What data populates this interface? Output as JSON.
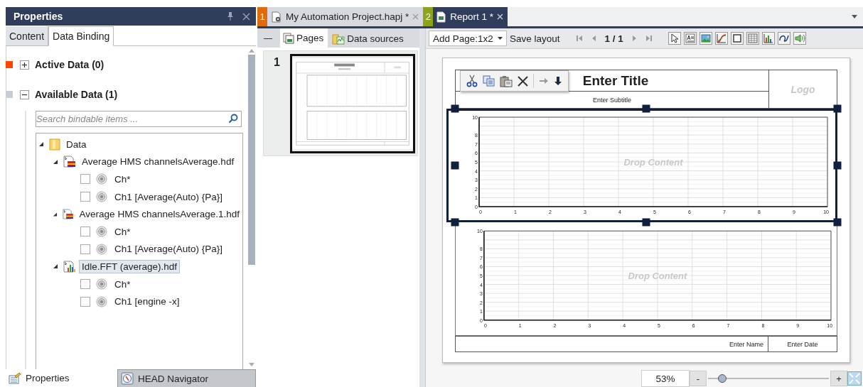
{
  "panel": {
    "title": "Properties",
    "tabs": [
      {
        "label": "Content",
        "selected": false
      },
      {
        "label": "Data Binding",
        "selected": true
      }
    ],
    "sections": [
      {
        "title": "Active Data (0)",
        "expanded": false,
        "color": "#ff4500"
      },
      {
        "title": "Available Data (1)",
        "expanded": true,
        "color": "#c8cdd4"
      }
    ],
    "search": {
      "placeholder": "Search bindable items ..."
    },
    "tree": [
      {
        "label": "Data",
        "kind": "folder",
        "expanded": true,
        "selected": false,
        "children": [
          {
            "label": "Average HMS channelsAverage.hdf",
            "kind": "average_file",
            "expanded": true,
            "selected": false,
            "children": [
              {
                "label": "Ch*",
                "kind": "channel",
                "checked": false
              },
              {
                "label": "Ch1  [Average(Auto) {Pa}]",
                "kind": "channel",
                "checked": false
              }
            ]
          },
          {
            "label": "Average HMS channelsAverage.1.hdf",
            "kind": "average_file",
            "expanded": true,
            "selected": false,
            "children": [
              {
                "label": "Ch*",
                "kind": "channel",
                "checked": false
              },
              {
                "label": "Ch1  [Average(Auto) {Pa}]",
                "kind": "channel",
                "checked": false
              }
            ]
          },
          {
            "label": "Idle.FFT (average).hdf",
            "kind": "fft_file",
            "expanded": true,
            "selected": true,
            "children": [
              {
                "label": "Ch*",
                "kind": "channel",
                "checked": false
              },
              {
                "label": "Ch1  [engine -x]",
                "kind": "channel",
                "checked": false
              }
            ]
          }
        ]
      }
    ],
    "bottom_tabs": [
      {
        "label": "Properties",
        "selected": true
      },
      {
        "label": "HEAD Navigator",
        "selected": false
      }
    ]
  },
  "documents": [
    {
      "number": "1",
      "title": "My Automation Project.hapj *",
      "color": "#e06a0c",
      "selected": false
    },
    {
      "number": "2",
      "title": "Report 1 *",
      "color": "#8da31a",
      "selected": true
    }
  ],
  "pages_panel": {
    "collapse": "—",
    "tabs": [
      {
        "label": "Pages",
        "selected": true
      },
      {
        "label": "Data sources",
        "selected": false
      }
    ],
    "pages": [
      {
        "number": "1",
        "selected": true
      }
    ]
  },
  "toolbar": {
    "add_page": "Add Page:1x2",
    "save": "Save layout",
    "page_indicator": "1 / 1"
  },
  "report": {
    "title": "Enter Title",
    "subtitle": "Enter Subtitle",
    "logo": "Logo",
    "charts": [
      {
        "placeholder": "Drop Content",
        "selected": true,
        "chart_data": {
          "type": "line",
          "grid": true,
          "xlim": [
            0,
            10
          ],
          "ylim": [
            0,
            10
          ],
          "xticks": [
            0,
            1,
            2,
            3,
            4,
            5,
            6,
            7,
            8,
            9,
            10
          ],
          "yticks": [
            0,
            1,
            2,
            3,
            4,
            5,
            6,
            7,
            8,
            10
          ]
        }
      },
      {
        "placeholder": "Drop Content",
        "selected": false,
        "chart_data": {
          "type": "line",
          "grid": true,
          "xlim": [
            0,
            10
          ],
          "ylim": [
            0,
            10
          ],
          "xticks": [
            0,
            1,
            2,
            3,
            4,
            5,
            6,
            7,
            8,
            9,
            10
          ],
          "yticks": [
            0,
            1,
            2,
            3,
            4,
            5,
            6,
            7,
            8,
            10
          ]
        }
      }
    ],
    "footer": {
      "name": "Enter Name",
      "date": "Enter Date"
    }
  },
  "zoom": {
    "value": "53%",
    "minus": "-",
    "plus": "+",
    "level": 0.12
  }
}
